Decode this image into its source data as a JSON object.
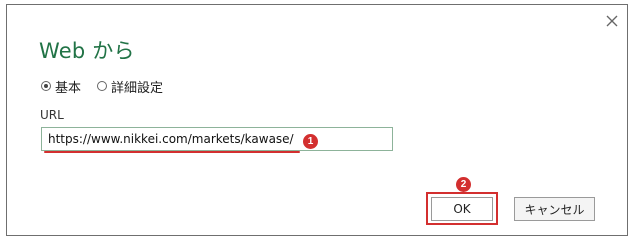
{
  "dialog": {
    "title": "Web から",
    "close_icon": "close-icon"
  },
  "mode": {
    "options": [
      {
        "label": "基本",
        "selected": true
      },
      {
        "label": "詳細設定",
        "selected": false
      }
    ]
  },
  "url_field": {
    "label": "URL",
    "value": "https://www.nikkei.com/markets/kawase/"
  },
  "annotations": {
    "marker_1": "1",
    "marker_2": "2",
    "accent_color": "#d32f2f"
  },
  "buttons": {
    "ok_label": "OK",
    "cancel_label": "キャンセル"
  },
  "colors": {
    "title": "#217346",
    "input_border": "#8db39a"
  }
}
